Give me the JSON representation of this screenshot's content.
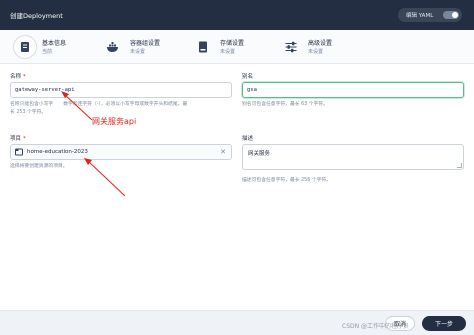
{
  "header": {
    "title": "创建Deployment",
    "yaml_label": "编辑 YAML"
  },
  "steps": [
    {
      "name": "基本信息",
      "status": "当前",
      "icon": "info-doc-icon"
    },
    {
      "name": "容器组设置",
      "status": "未设置",
      "icon": "docker-whale-icon"
    },
    {
      "name": "存储设置",
      "status": "未设置",
      "icon": "storage-disk-icon"
    },
    {
      "name": "高级设置",
      "status": "未设置",
      "icon": "sliders-icon"
    }
  ],
  "form": {
    "name": {
      "label": "名称",
      "value": "gateway-server-api",
      "hint_a": "名称只能包含小写字",
      "hint_b": "数字和连字符（-），必须以小写字母或数字开头和结尾，最",
      "hint_c": "长 253 个字符。"
    },
    "alias": {
      "label": "别名",
      "value": "gsa",
      "hint": "别名可包含任意字符，最长 63 个字符。"
    },
    "project": {
      "label": "项目",
      "value": "home-education-2023",
      "hint": "选择将要创建资源的项目。",
      "clear": "✕"
    },
    "description": {
      "label": "描述",
      "value": "网关服务",
      "hint": "描述可包含任意字符，最长 256 个字符。"
    }
  },
  "annotation": {
    "text": "网关服务api",
    "color": "#e0241b"
  },
  "footer": {
    "cancel_label": "取消",
    "next_label": "下一步"
  },
  "watermark": "CSDN @工作中的程序员"
}
